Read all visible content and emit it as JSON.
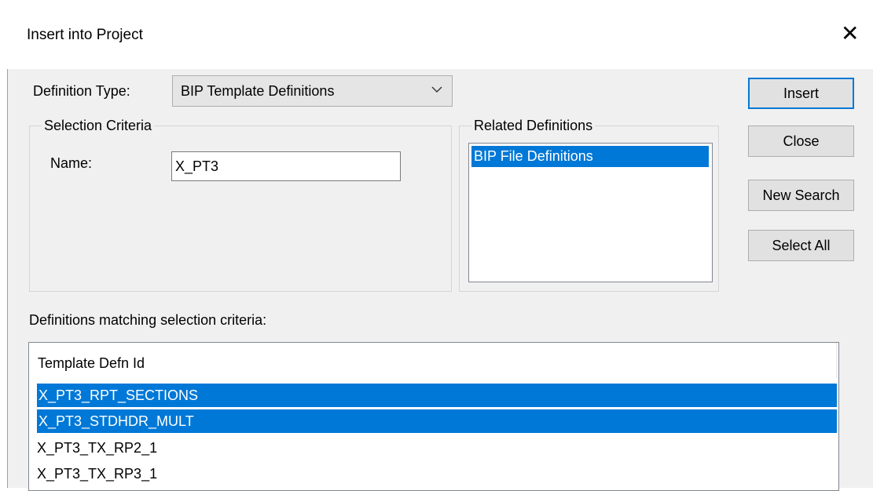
{
  "dialog": {
    "title": "Insert into Project"
  },
  "definition_type": {
    "label": "Definition Type:",
    "value": "BIP Template Definitions"
  },
  "selection_criteria": {
    "title": "Selection Criteria",
    "name_label": "Name:",
    "name_value": "X_PT3"
  },
  "related_definitions": {
    "title": "Related Definitions",
    "items": [
      "BIP File Definitions"
    ]
  },
  "buttons": {
    "insert": "Insert",
    "close": "Close",
    "new_search": "New Search",
    "select_all": "Select All"
  },
  "results": {
    "label": "Definitions matching selection criteria:",
    "column_header": "Template Defn Id",
    "rows": [
      {
        "value": "X_PT3_RPT_SECTIONS",
        "selected": true
      },
      {
        "value": "X_PT3_STDHDR_MULT",
        "selected": true
      },
      {
        "value": "X_PT3_TX_RP2_1",
        "selected": false
      },
      {
        "value": "X_PT3_TX_RP3_1",
        "selected": false
      }
    ]
  },
  "colors": {
    "selection": "#0078d7",
    "dialog_bg": "#f0f0f0"
  }
}
